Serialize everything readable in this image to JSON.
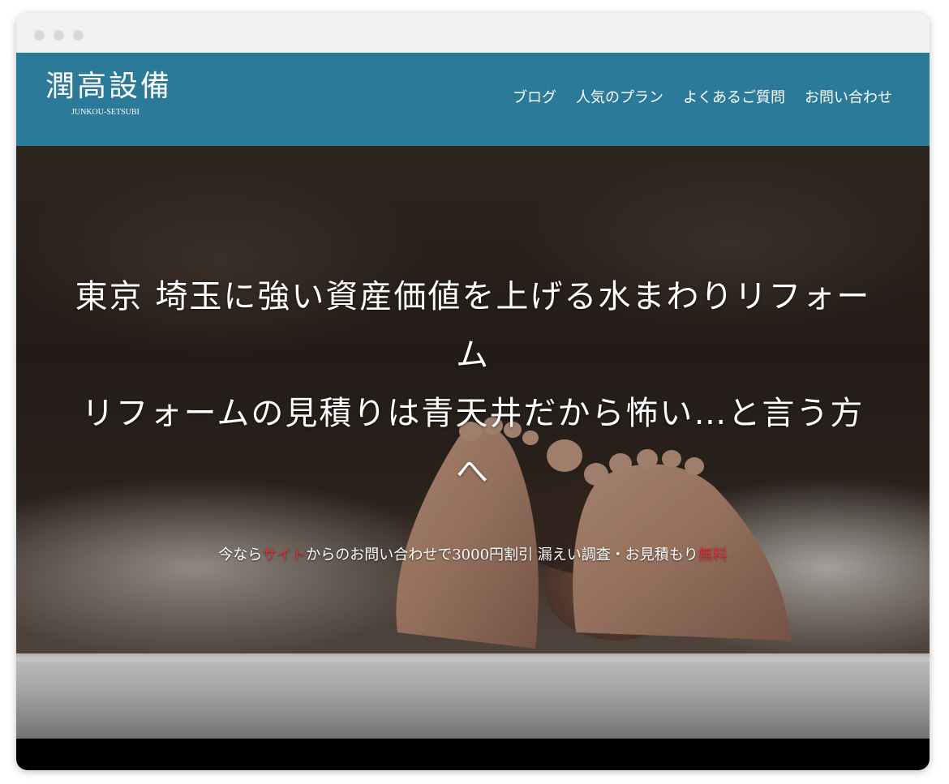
{
  "header": {
    "logo_text": "潤高設備",
    "logo_sub": "JUNKOU-SETSUBI",
    "nav": [
      {
        "label": "ブログ"
      },
      {
        "label": "人気のプラン"
      },
      {
        "label": "よくあるご質問"
      },
      {
        "label": "お問い合わせ"
      }
    ]
  },
  "hero": {
    "title_lines": [
      "東京 埼玉に強い資産価値を上げる水まわりリフォー",
      "ム",
      "リフォームの見積りは青天井だから怖い…と言う方",
      "へ"
    ],
    "subtitle": {
      "part1": "今なら",
      "part2": "サイト",
      "part3": "からのお問い合わせで3000円割引 漏えい調査・お見積もり",
      "part4": "無料"
    }
  },
  "colors": {
    "header_bg": "#2b7a99",
    "accent_red": "#e0303a",
    "footer_bg": "#000000"
  }
}
